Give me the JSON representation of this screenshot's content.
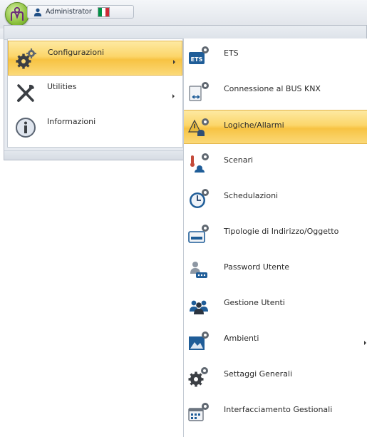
{
  "header": {
    "app_button_icon": "ohm-logo-icon",
    "user": {
      "icon": "user-icon",
      "name": "Administrator",
      "flag_icon": "italian-flag-icon",
      "flag_colors": [
        "#009246",
        "#ffffff",
        "#ce2b37"
      ]
    }
  },
  "colors": {
    "highlight": "#f9cf5f",
    "highlight_border": "#e3b44a",
    "icon_blue": "#1f5d98"
  },
  "main_menu": {
    "items": [
      {
        "label": "Configurazioni",
        "icon": "gears-icon",
        "selected": true,
        "has_submenu": true
      },
      {
        "label": "Utilities",
        "icon": "tools-icon",
        "selected": false,
        "has_submenu": true
      },
      {
        "label": "Informazioni",
        "icon": "info-icon",
        "selected": false,
        "has_submenu": false
      }
    ]
  },
  "submenu": {
    "items": [
      {
        "label": "ETS",
        "icon": "ets-icon",
        "selected": false
      },
      {
        "label": "Connessione al BUS KNX",
        "icon": "bus-connection-icon",
        "selected": false
      },
      {
        "label": "Logiche/Allarmi",
        "icon": "logic-alarm-icon",
        "selected": true
      },
      {
        "label": "Scenari",
        "icon": "scenarios-icon",
        "selected": false
      },
      {
        "label": "Schedulazioni",
        "icon": "schedule-clock-icon",
        "selected": false
      },
      {
        "label": "Tipologie di Indirizzo/Oggetto",
        "icon": "address-type-icon",
        "selected": false
      },
      {
        "label": "Password Utente",
        "icon": "user-password-icon",
        "selected": false
      },
      {
        "label": "Gestione Utenti",
        "icon": "users-management-icon",
        "selected": false
      },
      {
        "label": "Ambienti",
        "icon": "environments-icon",
        "selected": false,
        "has_submenu": true
      },
      {
        "label": "Settaggi Generali",
        "icon": "general-settings-icon",
        "selected": false
      },
      {
        "label": "Interfacciamento Gestionali",
        "icon": "management-interface-icon",
        "selected": false
      }
    ]
  }
}
